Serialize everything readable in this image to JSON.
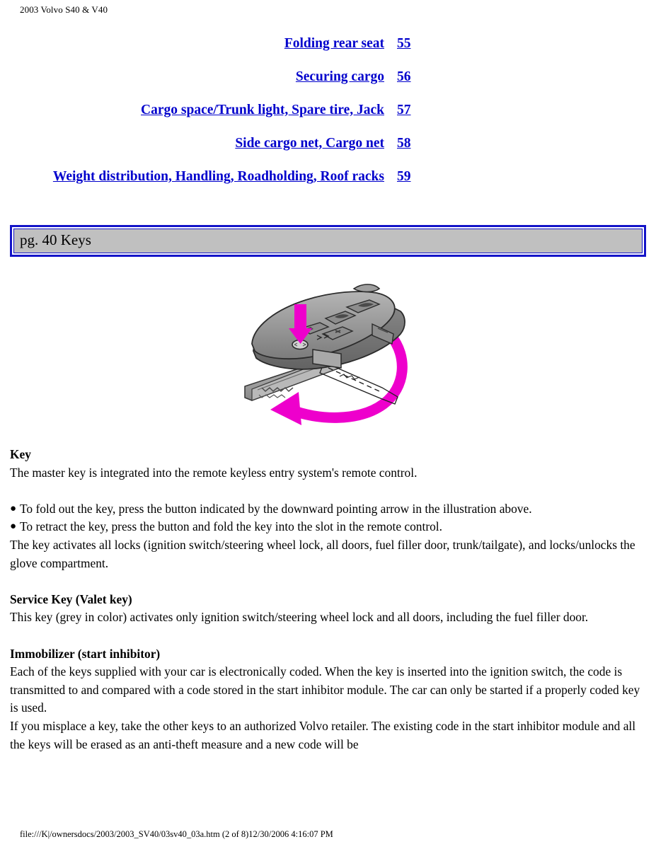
{
  "header": {
    "title": "2003 Volvo S40 & V40"
  },
  "toc": {
    "entries": [
      {
        "title": "Folding rear seat",
        "page": "55"
      },
      {
        "title": "Securing cargo",
        "page": "56"
      },
      {
        "title": "Cargo space/Trunk light, Spare tire, Jack",
        "page": "57"
      },
      {
        "title": "Side cargo net, Cargo net",
        "page": "58"
      },
      {
        "title": "Weight distribution, Handling, Roadholding, Roof racks",
        "page": "59"
      }
    ]
  },
  "section": {
    "title_bar": "pg. 40 Keys"
  },
  "illustration": {
    "name": "volvo-flip-key-remote",
    "arrow_color": "#ee00cc",
    "body_color": "#9a9a9a",
    "outline_color": "#2b2b2b",
    "annotations": [
      "downward-arrow-on-release-button",
      "curved-arrow-key-fold-out"
    ]
  },
  "body": {
    "key_heading": "Key",
    "key_intro": "The master key is integrated into the remote keyless entry system's remote control.",
    "bullets": [
      "To fold out the key, press the button indicated by the downward pointing arrow in the illustration above.",
      "To retract the key, press the button and fold the key into the slot in the remote control."
    ],
    "bullet_glyph": "●",
    "key_locks": "The key activates all locks (ignition switch/steering wheel lock, all doors, fuel filler door, trunk/tailgate), and locks/unlocks the glove compartment.",
    "service_heading": "Service Key (Valet key)",
    "service_text": "This key (grey in color) activates only ignition switch/steering wheel lock and all doors, including the fuel filler door.",
    "immobilizer_heading": "Immobilizer (start inhibitor)",
    "immobilizer_p1": "Each of the keys supplied with your car is electronically coded. When the key is inserted into the ignition switch, the code is transmitted to and compared with a code stored in the start inhibitor module. The car can only be started if a properly coded key is used.",
    "immobilizer_p2": "If you misplace a key, take the other keys to an authorized Volvo retailer. The existing code in the start inhibitor module and all the keys will be erased as an anti-theft measure and a new code will be"
  },
  "footer": {
    "path": "file:///K|/ownersdocs/2003/2003_SV40/03sv40_03a.htm (2 of 8)12/30/2006 4:16:07 PM"
  },
  "colors": {
    "link": "#0000cc",
    "title_bar_border": "#1414c8",
    "title_bar_fill": "#c0c0c0",
    "arrow": "#ee00cc"
  }
}
